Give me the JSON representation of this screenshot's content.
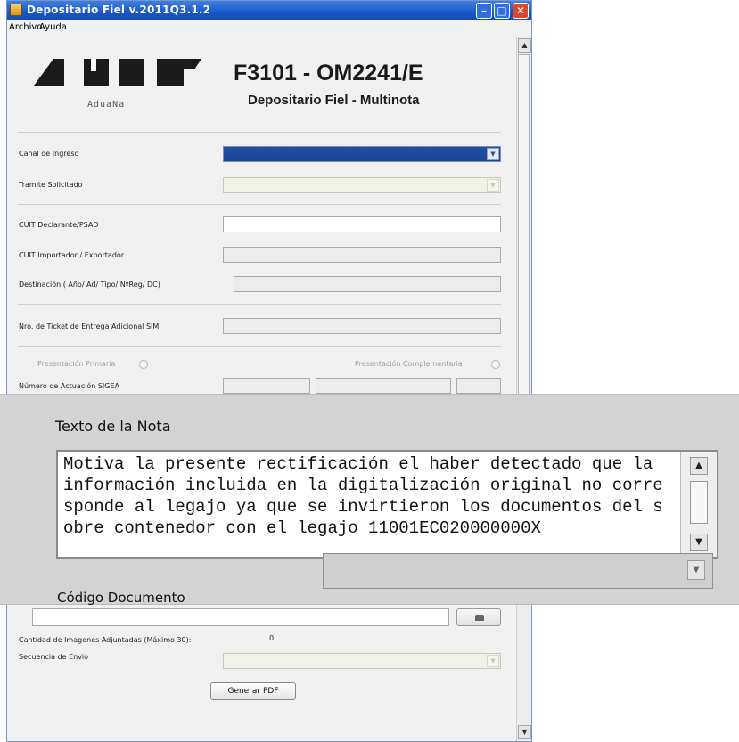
{
  "window": {
    "title": "Depositario Fiel v.2011Q3.1.2",
    "menu": [
      "Archivo",
      "Ayuda"
    ]
  },
  "header": {
    "logo_subtext": "AduaNa",
    "form_code": "F3101 - OM2241/E",
    "form_name": "Depositario Fiel - Multinota"
  },
  "fields": {
    "canal_ingreso": "Canal de Ingreso",
    "tramite_solicitado": "Tramite Solicitado",
    "cuit_declarante": "CUIT Declarante/PSAD",
    "cuit_importador": "CUIT Importador / Exportador",
    "destinacion": "Destinación ( Año/  Ad/ Tipo/ NºReg/ DC)",
    "nro_ticket": "Nro. de Ticket de Entrega Adicional SIM",
    "presentacion_primaria": "Presentación Primaria",
    "presentacion_complementaria": "Presentación Complementaria",
    "numero_actuacion": "Número de Actuación SIGEA",
    "cantidad_imagenes": "Cantidad de Imagenes Adjuntadas (Máximo 30):",
    "cantidad_imagenes_value": "0",
    "secuencia_envio": "Secuencia de Envio"
  },
  "zoom": {
    "texto_nota_label": "Texto de la Nota",
    "nota_lines": [
      "Motiva la presente rectificación el haber detectado que la",
      "información incluida en la digitalización original no corre",
      "sponde al legajo ya que se invirtieron los documentos del s",
      "obre contenedor con el legajo 11001EC020000000X"
    ],
    "codigo_documento_label": "Código Documento"
  },
  "buttons": {
    "generar_pdf": "Generar PDF"
  },
  "colors": {
    "titlebar": "#1a56c8",
    "canal_selected": "#1f4ea3",
    "overlay_bg": "#d3d3d3"
  },
  "icons": [
    "app-icon",
    "minimize-icon",
    "maximize-icon",
    "close-icon",
    "chevron-down-icon",
    "scroll-up-icon",
    "scroll-down-icon",
    "attach-icon"
  ]
}
